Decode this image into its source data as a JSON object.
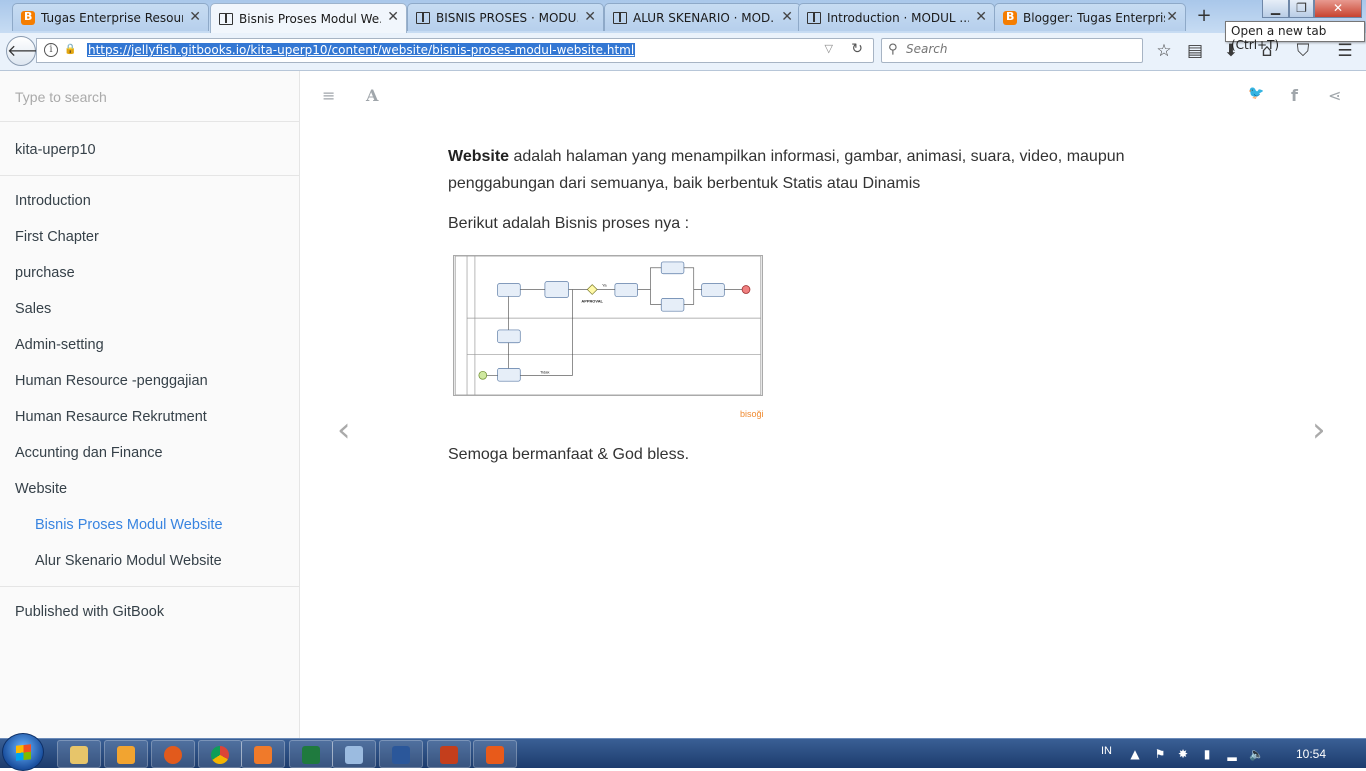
{
  "browser": {
    "tabs": [
      {
        "label": "Tugas Enterprise Resour...",
        "icon": "blogger"
      },
      {
        "label": "Bisnis Proses Modul We...",
        "icon": "book",
        "active": true
      },
      {
        "label": "BISNIS PROSES · MODU...",
        "icon": "book"
      },
      {
        "label": "ALUR SKENARIO · MOD...",
        "icon": "book"
      },
      {
        "label": "Introduction · MODUL ...",
        "icon": "book"
      },
      {
        "label": "Blogger: Tugas Enterpris...",
        "icon": "blogger"
      }
    ],
    "new_tab_label": "+",
    "tooltip": "Open a new tab (Ctrl+T)",
    "url": "https://jellyfish.gitbooks.io/kita-uperp10/content/website/bisnis-proses-modul-website.html",
    "search_placeholder": "Search"
  },
  "sidebar": {
    "search_placeholder": "Type to search",
    "book_title": "kita-uperp10",
    "items": [
      {
        "label": "Introduction"
      },
      {
        "label": "First Chapter"
      },
      {
        "label": "purchase"
      },
      {
        "label": "Sales"
      },
      {
        "label": "Admin-setting"
      },
      {
        "label": "Human Resource -penggajian"
      },
      {
        "label": "Human Resaurce Rekrutment"
      },
      {
        "label": "Accunting dan Finance"
      },
      {
        "label": "Website"
      }
    ],
    "sub_items": [
      {
        "label": "Bisnis Proses Modul Website",
        "active": true
      },
      {
        "label": "Alur Skenario Modul Website"
      }
    ],
    "footer": "Published with GitBook"
  },
  "content": {
    "intro_bold": "Website",
    "intro_rest": " adalah halaman yang menampilkan informasi, gambar, animasi, suara, video, maupun penggabungan dari semuanya, baik berbentuk Statis atau Dinamis",
    "process_intro": "Berikut adalah Bisnis proses nya :",
    "closing": "Semoga bermanfaat & God bless.",
    "diagram": {
      "approval_label": "APPROVAL",
      "yes_label": "Ya",
      "no_label": "Tidak"
    },
    "watermark": "bisoği"
  },
  "taskbar": {
    "language": "IN",
    "clock": "10:54"
  },
  "colors": {
    "accent": "#3884e0",
    "text": "#364149"
  }
}
